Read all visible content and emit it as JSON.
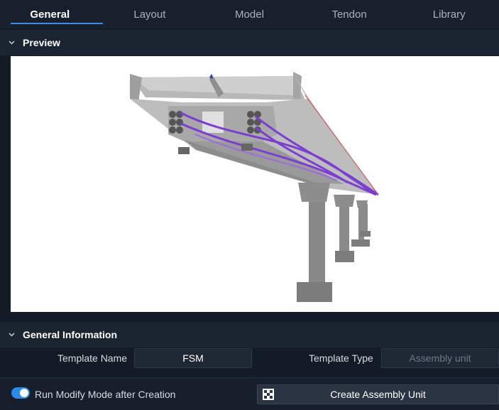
{
  "tabs": [
    {
      "label": "General",
      "active": true
    },
    {
      "label": "Layout",
      "active": false
    },
    {
      "label": "Model",
      "active": false
    },
    {
      "label": "Tendon",
      "active": false
    },
    {
      "label": "Library",
      "active": false
    }
  ],
  "preview": {
    "title": "Preview",
    "image": "3d-bridge-model-icon"
  },
  "general_information": {
    "title": "General Information",
    "template_name_label": "Template Name",
    "template_name_value": "FSM",
    "template_type_label": "Template Type",
    "template_type_value": "Assembly unit"
  },
  "footer": {
    "toggle_label": "Run Modify Mode after Creation",
    "toggle_on": true,
    "create_button_label": "Create Assembly Unit",
    "create_button_icon": "assembly-unit-icon"
  },
  "colors": {
    "accent": "#2a8be8",
    "background": "#131b26",
    "tendon": "#7a3fd1"
  }
}
